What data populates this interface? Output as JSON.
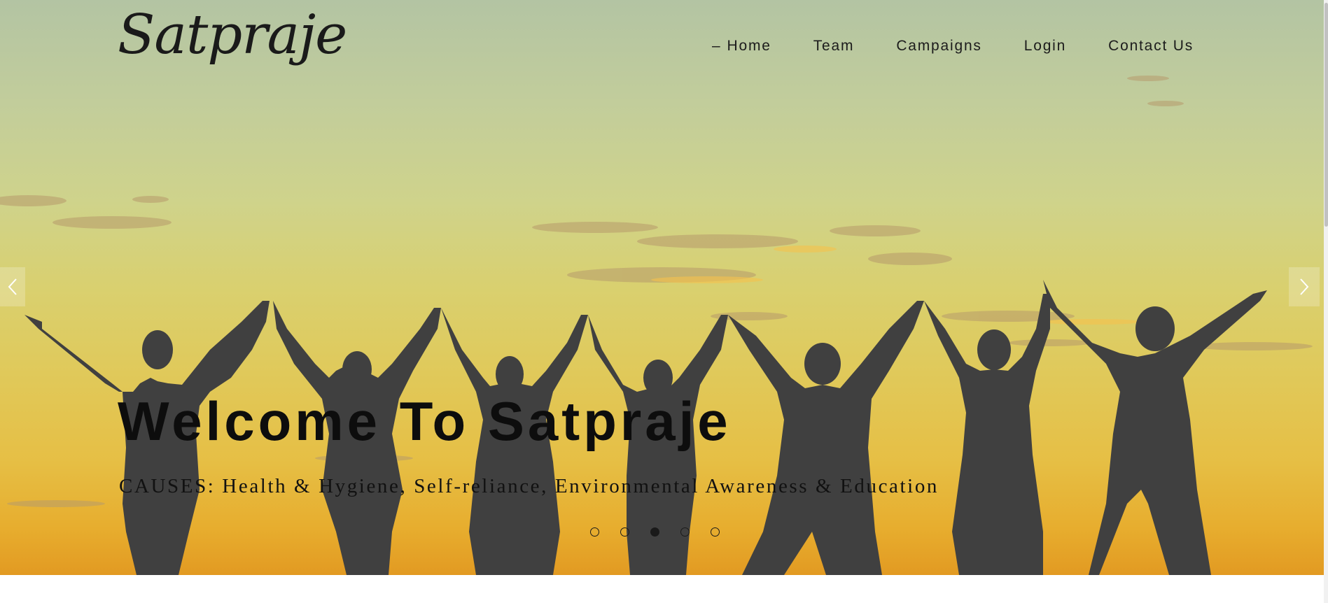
{
  "brand": {
    "logo_text": "Satpraje"
  },
  "nav": {
    "items": [
      {
        "label": "Home",
        "active": true,
        "marker": "–"
      },
      {
        "label": "Team",
        "active": false
      },
      {
        "label": "Campaigns",
        "active": false
      },
      {
        "label": "Login",
        "active": false
      },
      {
        "label": "Contact Us",
        "active": false
      }
    ]
  },
  "hero": {
    "headline": "Welcome To Satpraje",
    "subheadline": "CAUSES: Health & Hygiene, Self-reliance, Environmental Awareness & Education",
    "slide_count": 5,
    "active_slide": 3,
    "prev_icon": "chevron-left-icon",
    "next_icon": "chevron-right-icon",
    "image_subject": "silhouettes-of-women-raising-joined-hands-at-sunset"
  },
  "colors": {
    "text_dark": "#1a1a1a",
    "silhouette": "#404040",
    "sky_top": "#b3c4a3",
    "sky_bottom": "#e29a22"
  }
}
